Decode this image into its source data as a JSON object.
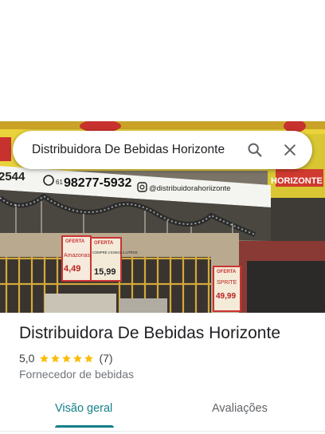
{
  "search": {
    "query": "Distribuidora De Bebidas Horizonte"
  },
  "icons": {
    "search": "search-icon",
    "close": "close-icon",
    "star": "star-icon"
  },
  "hero": {
    "phone_area": "61",
    "phone": "98277-5932",
    "phone_left": "2544",
    "instagram": "@distribuidorahoriizonte",
    "sign_brand": "HORIZONTE",
    "poster_offer_1": "OFERTA",
    "poster_product_1": "Amazonas",
    "poster_price_1": "4,49",
    "poster_offer_2": "OFERTA",
    "poster_product_2": "COMPRE 2 ESKOL 2 LITROS",
    "poster_price_2": "15,99",
    "poster_offer_3": "OFERTA",
    "poster_product_3": "SPRITE",
    "poster_price_3": "49,99"
  },
  "place": {
    "name": "Distribuidora De Bebidas Horizonte",
    "rating": "5,0",
    "stars": 5,
    "reviews": "(7)",
    "category": "Fornecedor de bebidas"
  },
  "tabs": [
    {
      "label": "Visão geral",
      "active": true
    },
    {
      "label": "Avaliações",
      "active": false
    }
  ],
  "colors": {
    "accent": "#137f88",
    "star": "#fbbc04",
    "text": "#202124"
  }
}
